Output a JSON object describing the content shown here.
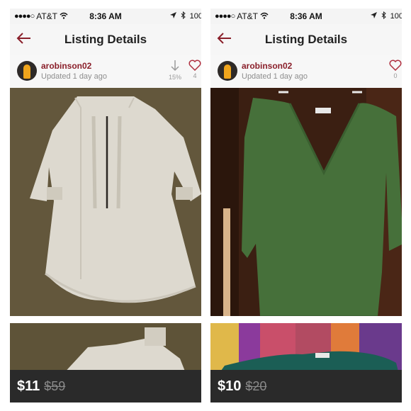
{
  "left": {
    "status": {
      "carrier": "AT&T",
      "time": "8:36 AM",
      "battery": "100"
    },
    "nav_title": "Listing Details",
    "user": {
      "name": "arobinson02",
      "updated": "Updated 1 day ago"
    },
    "stats": {
      "price_drop_label": "15%",
      "likes": "4"
    },
    "price": "$11",
    "original_price": "$59"
  },
  "right": {
    "status": {
      "carrier": "AT&T",
      "time": "8:36 AM",
      "battery": "100"
    },
    "nav_title": "Listing Details",
    "user": {
      "name": "arobinson02",
      "updated": "Updated 1 day ago"
    },
    "stats": {
      "likes": "0"
    },
    "price": "$10",
    "original_price": "$20"
  },
  "icons": {
    "back": "back-arrow-icon",
    "heart": "heart-icon",
    "down": "down-arrow-icon",
    "wifi": "wifi-icon",
    "bluetooth": "bluetooth-icon",
    "location": "location-icon"
  },
  "colors": {
    "accent": "#8a1f2a",
    "price_bar": "#2a2a2a"
  }
}
